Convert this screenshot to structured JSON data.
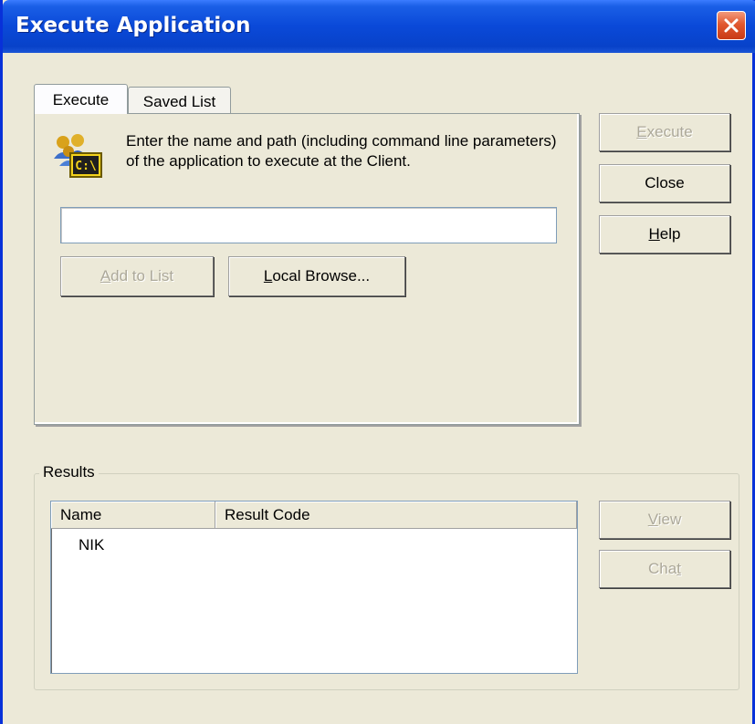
{
  "window": {
    "title": "Execute Application"
  },
  "tabs": [
    {
      "label": "Execute"
    },
    {
      "label": "Saved List"
    }
  ],
  "execute_tab": {
    "description": "Enter the name and path (including command line parameters) of the application to execute at the Client.",
    "path_input": {
      "value": "",
      "placeholder": ""
    },
    "add_to_list_prefix": "",
    "add_to_list_key": "A",
    "add_to_list_rest": "dd to List",
    "local_browse_key": "L",
    "local_browse_rest": "ocal Browse..."
  },
  "side_buttons": {
    "execute_key": "E",
    "execute_rest": "xecute",
    "close": "Close",
    "help_key": "H",
    "help_rest": "elp"
  },
  "results": {
    "group_label": "Results",
    "columns": [
      "Name",
      "Result Code"
    ],
    "rows": [
      {
        "name": "NIK",
        "result_code": ""
      }
    ],
    "view_key": "V",
    "view_rest": "iew",
    "chat_prefix": "Cha",
    "chat_key": "t"
  },
  "icons": {
    "close": "close-x-icon",
    "app": "users-command-prompt-icon"
  },
  "colors": {
    "title_bar": "#0a49d8",
    "dialog_bg": "#ece9d8",
    "close_button": "#e1582f",
    "disabled_text": "#aca899"
  }
}
